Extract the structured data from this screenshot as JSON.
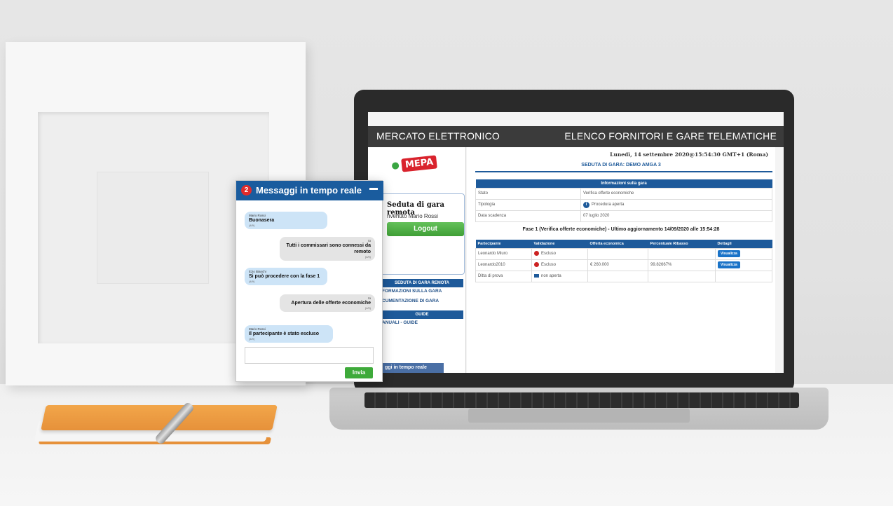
{
  "app": {
    "header_left": "MERCATO ELETTRONICO",
    "header_right": "ELENCO FORNITORI E GARE TELEMATICHE",
    "logo_text": "MEPA"
  },
  "sidebar": {
    "seduta_title": "Seduta di gara remota",
    "welcome": "nvenuto Mario Rossi",
    "logout_label": "Logout",
    "section1_head": "SEDUTA DI GARA REMOTA",
    "section1_links": [
      "FORMAZIONI SULLA GARA",
      "CUMENTAZIONE DI GARA"
    ],
    "section2_head": "GUIDE",
    "section2_links": [
      "ANUALI - GUIDE"
    ],
    "footer_tab": "ggi in tempo reale"
  },
  "main": {
    "date": "Lunedì, 14 settembre 2020@15:54:30 GMT+1 (Roma)",
    "gara_title": "SEDUTA DI GARA: DEMO AMGA 3",
    "info_head": "Informazioni sulla gara",
    "info_rows": [
      {
        "label": "Stato",
        "value": "Verifica offerte economiche"
      },
      {
        "label": "Tipologia",
        "value": "Procedura aperta"
      },
      {
        "label": "Data scadenza",
        "value": "07 luglio 2020"
      }
    ],
    "fase_line": "Fase 1 (Verifica offerte economiche) - Ultimo aggiornamento 14/09/2020 alle 15:54:28",
    "columns": [
      "Partecipante",
      "Validazione",
      "Offerta economica",
      "Percentuale Ribasso",
      "Dettagli"
    ],
    "rows": [
      {
        "name": "Leonardo Miuro",
        "status": "Escluso",
        "offer": "",
        "pct": "",
        "detail": "Visualizza"
      },
      {
        "name": "Leonardo2010",
        "status": "Escluso",
        "offer": "€ 260.000",
        "pct": "99.82667%",
        "detail": "Visualizza"
      },
      {
        "name": "Ditta di prova",
        "status": "non aperta",
        "offer": "",
        "pct": "",
        "detail": ""
      }
    ]
  },
  "chat": {
    "badge": "2",
    "title": "Messaggi in tempo reale",
    "messages": [
      {
        "who": "Mario Rossi",
        "text": "Buonasera",
        "time": "(4/9)"
      },
      {
        "who": "Io",
        "text": "Tutti i commissari sono connessi da remoto",
        "time": "(4/9)"
      },
      {
        "who": "Ezio Bianchi",
        "text": "Si può procedere con la fase 1",
        "time": "(4/9)"
      },
      {
        "who": "Io",
        "text": "Apertura delle offerte economiche",
        "time": "(4/9)"
      },
      {
        "who": "Mario Rossi",
        "text": "Il partecipante è stato escluso",
        "time": "(4/9)"
      }
    ],
    "send_label": "Invia"
  }
}
